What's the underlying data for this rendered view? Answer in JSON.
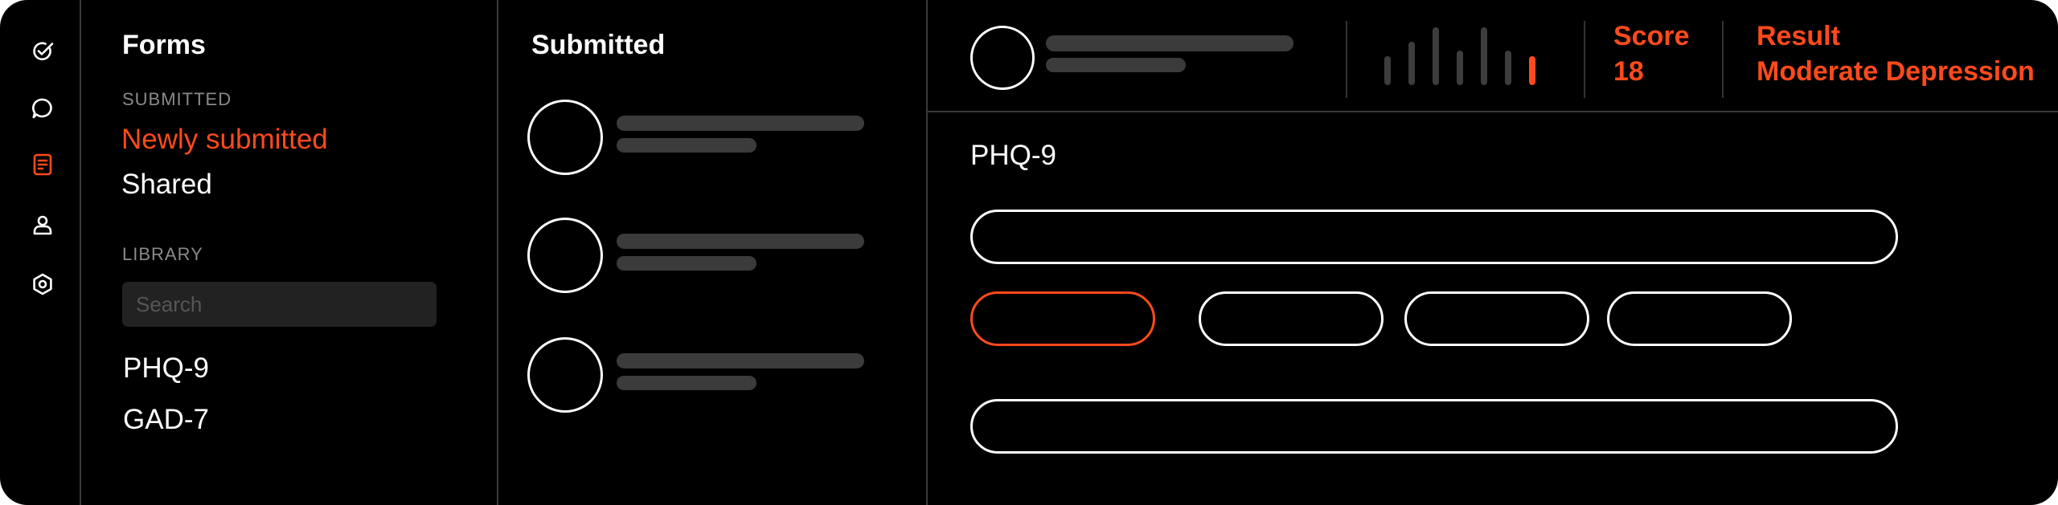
{
  "rail": {
    "icons": [
      "tasks-check-icon",
      "chat-bubble-icon",
      "forms-icon",
      "person-icon",
      "settings-hexagon-icon"
    ],
    "active_color": "#ff4a1c"
  },
  "forms_nav": {
    "title": "Forms",
    "submitted_label": "SUBMITTED",
    "submitted_items": [
      {
        "label": "Newly submitted",
        "active": true
      },
      {
        "label": "Shared",
        "active": false
      }
    ],
    "library_label": "LIBRARY",
    "search_placeholder": "Search",
    "library_items": [
      {
        "label": "PHQ-9"
      },
      {
        "label": "GAD-7"
      }
    ]
  },
  "submitted_list": {
    "title": "Submitted",
    "item_count_visible": 3
  },
  "detail": {
    "score_label": "Score",
    "score_value": "18",
    "result_label": "Result",
    "result_value": "Moderate Depression",
    "score_levels": [
      0.5,
      0.75,
      1.0,
      0.6,
      1.0,
      0.6,
      0.5
    ],
    "highlighted_level_index": 6,
    "form_title": "PHQ-9",
    "answer_options_count": 4,
    "selected_option_index": 0
  },
  "colors": {
    "accent": "#ff4a1c",
    "background": "#000000",
    "skeleton": "#3b3b3b"
  }
}
